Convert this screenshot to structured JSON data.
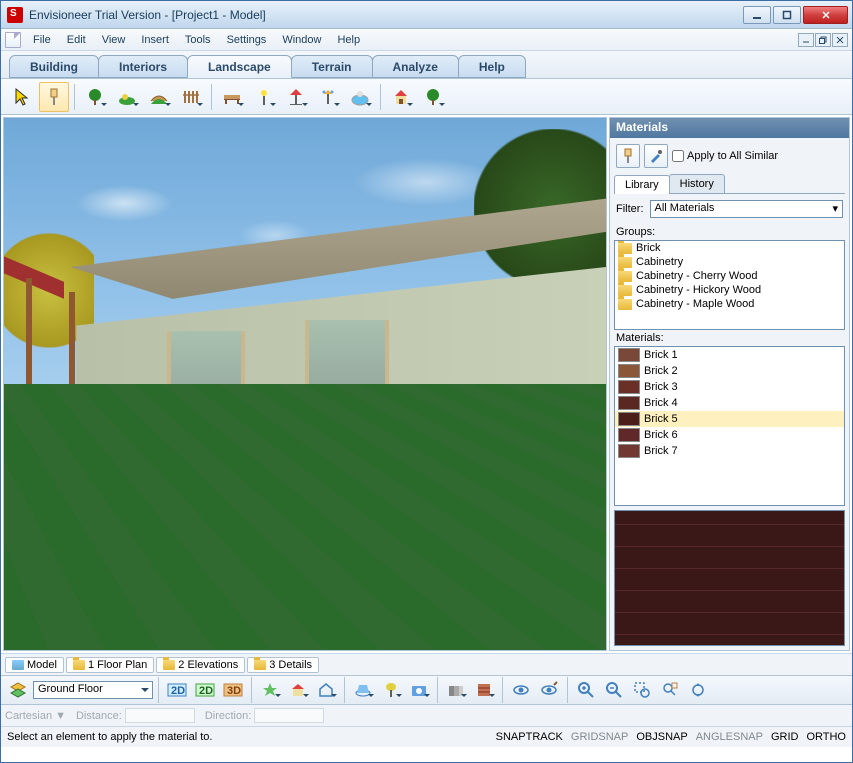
{
  "window": {
    "title": "Envisioneer Trial Version - [Project1 - Model]"
  },
  "menu": {
    "items": [
      "File",
      "Edit",
      "View",
      "Insert",
      "Tools",
      "Settings",
      "Window",
      "Help"
    ]
  },
  "ribbon": {
    "tabs": [
      "Building",
      "Interiors",
      "Landscape",
      "Terrain",
      "Analyze",
      "Help"
    ],
    "active": 2
  },
  "viewtabs": {
    "items": [
      {
        "label": "Model",
        "icon": "model"
      },
      {
        "label": "1 Floor Plan",
        "icon": "folder"
      },
      {
        "label": "2 Elevations",
        "icon": "folder"
      },
      {
        "label": "3 Details",
        "icon": "folder"
      }
    ]
  },
  "floor_combo": "Ground Floor",
  "materials": {
    "title": "Materials",
    "apply_all": "Apply to All Similar",
    "tabs": {
      "library": "Library",
      "history": "History"
    },
    "filter_label": "Filter:",
    "filter_value": "All Materials",
    "groups_label": "Groups:",
    "groups": [
      "Brick",
      "Cabinetry",
      "Cabinetry - Cherry Wood",
      "Cabinetry - Hickory Wood",
      "Cabinetry - Maple Wood"
    ],
    "materials_label": "Materials:",
    "list": [
      {
        "name": "Brick 1",
        "color": "#7a4838"
      },
      {
        "name": "Brick 2",
        "color": "#8a5838"
      },
      {
        "name": "Brick 3",
        "color": "#6a3028"
      },
      {
        "name": "Brick 4",
        "color": "#5a2820"
      },
      {
        "name": "Brick 5",
        "color": "#4a2018",
        "selected": true
      },
      {
        "name": "Brick 6",
        "color": "#602828"
      },
      {
        "name": "Brick 7",
        "color": "#703830"
      }
    ]
  },
  "coord": {
    "mode": "Cartesian",
    "dist": "Distance:",
    "dir": "Direction:"
  },
  "status": {
    "message": "Select an element to apply the material to.",
    "snaps": [
      {
        "label": "SNAPTRACK",
        "on": true
      },
      {
        "label": "GRIDSNAP",
        "on": false
      },
      {
        "label": "OBJSNAP",
        "on": true
      },
      {
        "label": "ANGLESNAP",
        "on": false
      },
      {
        "label": "GRID",
        "on": true
      },
      {
        "label": "ORTHO",
        "on": true
      }
    ]
  }
}
